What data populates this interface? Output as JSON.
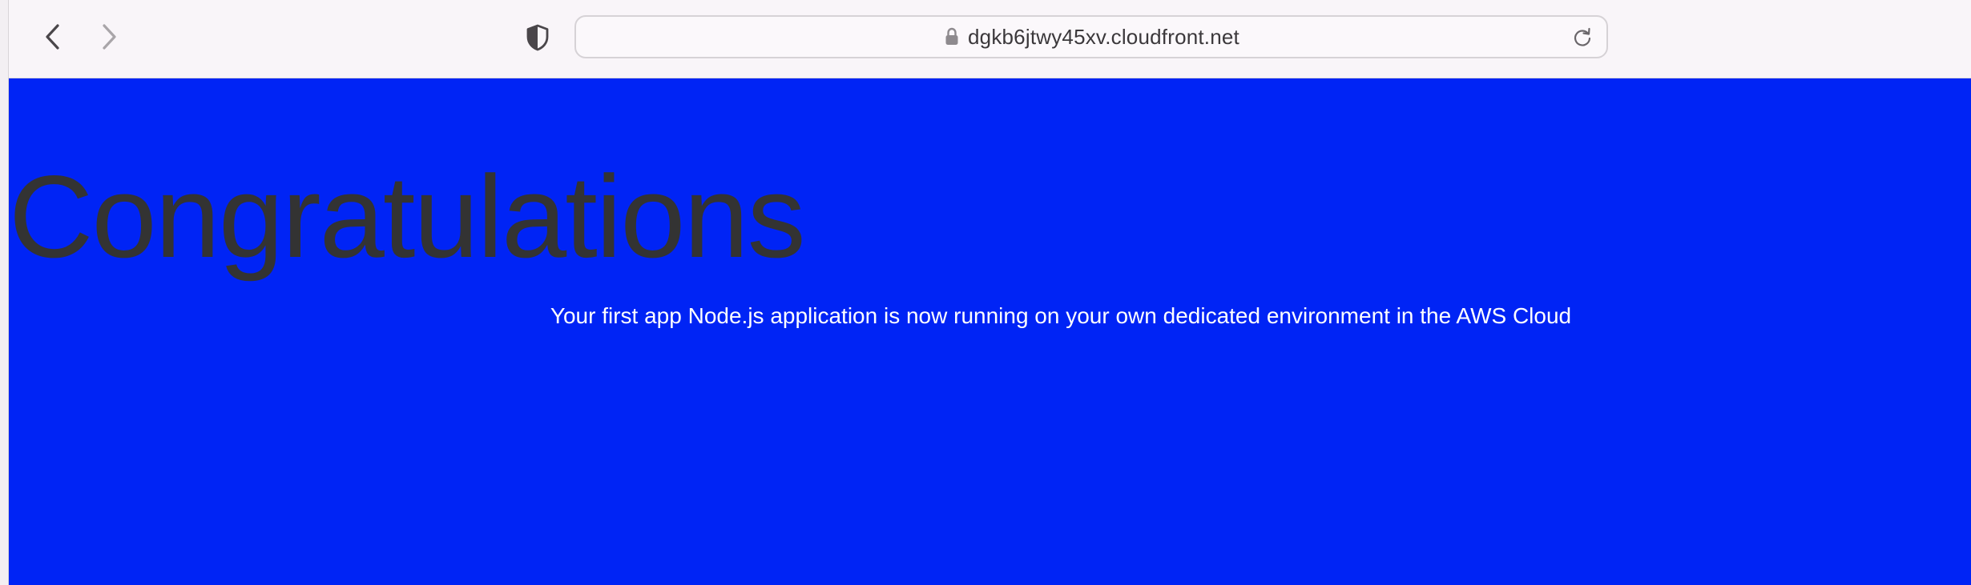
{
  "browser": {
    "url": "dgkb6jtwy45xv.cloudfront.net",
    "icons": {
      "back": "chevron-left-icon",
      "forward": "chevron-right-icon",
      "privacy": "shield-icon",
      "secure": "lock-icon",
      "reload": "reload-icon"
    }
  },
  "page": {
    "headline": "Congratulations",
    "message": "Your first app Node.js application is now running on your own dedicated environment in the AWS Cloud",
    "colors": {
      "background": "#0024f5",
      "headline": "#333333",
      "message": "#ffffff"
    }
  }
}
